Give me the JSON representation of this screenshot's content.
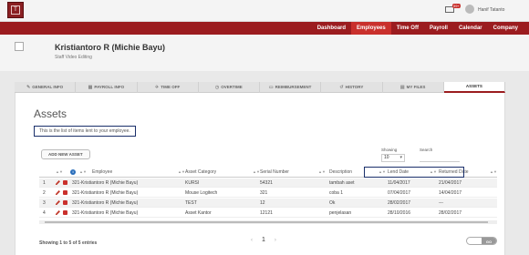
{
  "topbar": {
    "logo_text": "T",
    "message_count": "99+",
    "username": "Hanif Tatanto"
  },
  "nav": {
    "items": [
      "Dashboard",
      "Employees",
      "Time Off",
      "Payroll",
      "Calendar",
      "Company"
    ],
    "active": "Employees"
  },
  "profile": {
    "name": "Kristiantoro R (Michie Bayu)",
    "role": "Staff Video Editing"
  },
  "tabs": [
    {
      "label": "GENERAL INFO",
      "icon": "pencil-icon"
    },
    {
      "label": "PAYROLL INFO",
      "icon": "table-icon"
    },
    {
      "label": "TIME OFF",
      "icon": "plane-icon"
    },
    {
      "label": "OVERTIME",
      "icon": "clock-icon"
    },
    {
      "label": "REIMBURSEMENT",
      "icon": "money-icon"
    },
    {
      "label": "HISTORY",
      "icon": "history-icon"
    },
    {
      "label": "MY FILES",
      "icon": "file-icon"
    },
    {
      "label": "ASSETS",
      "icon": ""
    }
  ],
  "assets": {
    "title": "Assets",
    "description": "This is the list of items lent to your employee.",
    "add_button": "ADD NEW ASSET",
    "showing_label": "Showing",
    "showing_value": "10",
    "search_label": "Search",
    "columns": {
      "employee": "Employee",
      "category": "Asset Category",
      "serial": "Serial Number",
      "description": "Description",
      "lend_date": "Lend Date",
      "returned_date": "Returned Date"
    },
    "rows": [
      {
        "no": "1",
        "employee": "321-Kristiantoro R (Michie Bayu)",
        "category": "KURSI",
        "serial": "54321",
        "description": "tambah aset",
        "lend": "11/04/2017",
        "returned": "21/04/2017"
      },
      {
        "no": "2",
        "employee": "321-Kristiantoro R (Michie Bayu)",
        "category": "Mouse Logitech",
        "serial": "321",
        "description": "coba 1",
        "lend": "07/04/2017",
        "returned": "14/04/2017"
      },
      {
        "no": "3",
        "employee": "321-Kristiantoro R (Michie Bayu)",
        "category": "TEST",
        "serial": "12",
        "description": "Ok",
        "lend": "28/02/2017",
        "returned": "---"
      },
      {
        "no": "4",
        "employee": "321-Kristiantoro R (Michie Bayu)",
        "category": "Asset Kantor",
        "serial": "12121",
        "description": "penjelasan",
        "lend": "28/10/2016",
        "returned": "28/02/2017"
      }
    ],
    "entries_text": "Showing 1 to 5 of 5 entries",
    "page": "1",
    "go_label": "GO"
  },
  "colors": {
    "brand": "#9b1c1f",
    "nav_active": "#c9302c",
    "highlight_box": "#1a2f6a"
  }
}
